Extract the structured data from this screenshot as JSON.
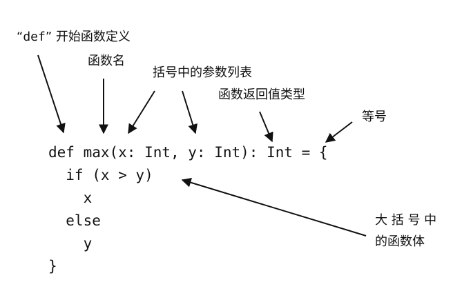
{
  "annotations": {
    "def_keyword": {
      "quote_open": "“",
      "keyword": "def",
      "quote_close": "”",
      "text": " 开始函数定义"
    },
    "function_name": "函数名",
    "param_list": "括号中的参数列表",
    "return_type": "函数返回值类型",
    "equals": "等号",
    "body_line1": "大 括 号 中",
    "body_line2": "的函数体"
  },
  "code": [
    "def max(x: Int, y: Int): Int = {",
    "  if (x > y)",
    "    x",
    "  else",
    "    y",
    "}"
  ]
}
